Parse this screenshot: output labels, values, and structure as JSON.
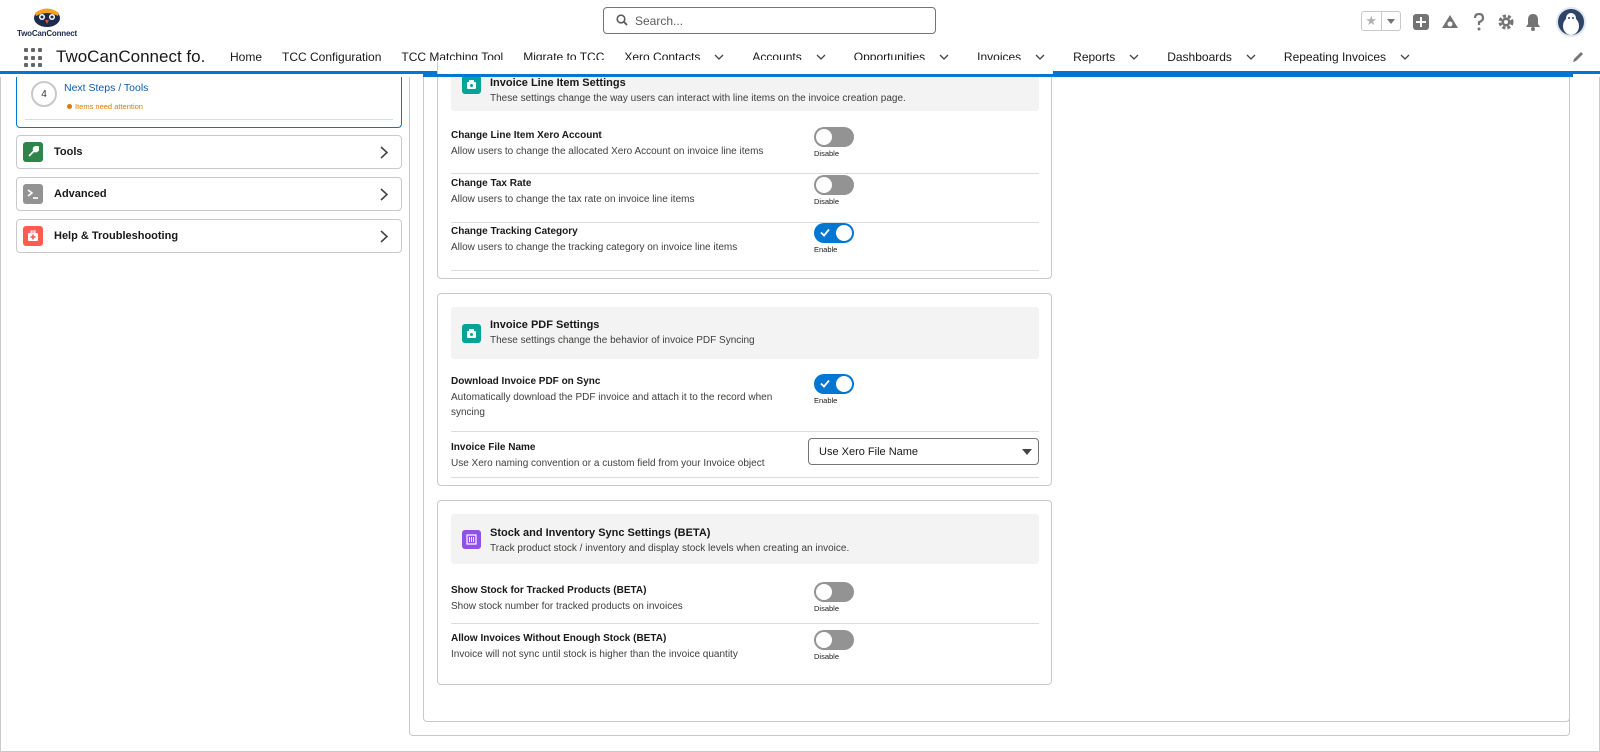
{
  "header": {
    "logo_text": "TwoCanConnect",
    "search_placeholder": "Search...",
    "icons": [
      "favorites-star-icon",
      "favorites-dropdown-icon",
      "add-icon",
      "trailhead-icon",
      "help-icon",
      "setup-gear-icon",
      "notifications-bell-icon",
      "user-avatar"
    ]
  },
  "nav": {
    "app_name": "TwoCanConnect fo...",
    "items": [
      {
        "label": "Home",
        "dropdown": false
      },
      {
        "label": "TCC Configuration",
        "dropdown": false
      },
      {
        "label": "TCC Matching Tool",
        "dropdown": false
      },
      {
        "label": "Migrate to TCC",
        "dropdown": false
      },
      {
        "label": "Xero Contacts",
        "dropdown": true
      },
      {
        "label": "Accounts",
        "dropdown": true
      },
      {
        "label": "Opportunities",
        "dropdown": true
      },
      {
        "label": "Invoices",
        "dropdown": true
      },
      {
        "label": "Reports",
        "dropdown": true
      },
      {
        "label": "Dashboards",
        "dropdown": true
      },
      {
        "label": "Repeating Invoices",
        "dropdown": true
      }
    ]
  },
  "sidebar": {
    "step": {
      "number": "4",
      "label": "Next Steps / Tools",
      "attention": "Items need attention"
    },
    "accordions": [
      {
        "label": "Tools",
        "icon": "wrench-icon",
        "color": "#2e844a"
      },
      {
        "label": "Advanced",
        "icon": "terminal-icon",
        "color": "#939393"
      },
      {
        "label": "Help & Troubleshooting",
        "icon": "first-aid-icon",
        "color": "#fe5c4c"
      }
    ]
  },
  "sections": {
    "line_items": {
      "title": "Invoice Line Item Settings",
      "desc": "These settings change the way users can interact with line items on the invoice creation page.",
      "rows": [
        {
          "title": "Change Line Item Xero Account",
          "desc": "Allow users to change the allocated Xero Account on invoice line items",
          "state": "Disable",
          "enabled": false
        },
        {
          "title": "Change Tax Rate",
          "desc": "Allow users to change the tax rate on invoice line items",
          "state": "Disable",
          "enabled": false
        },
        {
          "title": "Change Tracking Category",
          "desc": "Allow users to change the tracking category on invoice line items",
          "state": "Enable",
          "enabled": true
        }
      ]
    },
    "pdf": {
      "title": "Invoice PDF Settings",
      "desc": "These settings change the behavior of invoice PDF Syncing",
      "download": {
        "title": "Download Invoice PDF on Sync",
        "desc": "Automatically download the PDF invoice and attach it to the record when syncing",
        "state": "Enable",
        "enabled": true
      },
      "filename": {
        "title": "Invoice File Name",
        "desc": "Use Xero naming convention or a custom field from your Invoice object",
        "value": "Use Xero File Name"
      }
    },
    "stock": {
      "title": "Stock and Inventory Sync Settings (BETA)",
      "desc": "Track product stock / inventory and display stock levels when creating an invoice.",
      "rows": [
        {
          "title": "Show Stock for Tracked Products (BETA)",
          "desc": "Show stock number for tracked products on invoices",
          "state": "Disable",
          "enabled": false
        },
        {
          "title": "Allow Invoices Without Enough Stock (BETA)",
          "desc": "Invoice will not sync until stock is higher than the invoice quantity",
          "state": "Disable",
          "enabled": false
        }
      ]
    }
  },
  "colors": {
    "brand": "#0176d3",
    "teal": "#04a39a",
    "purple": "#9050e9",
    "toggle_off": "#939393"
  }
}
